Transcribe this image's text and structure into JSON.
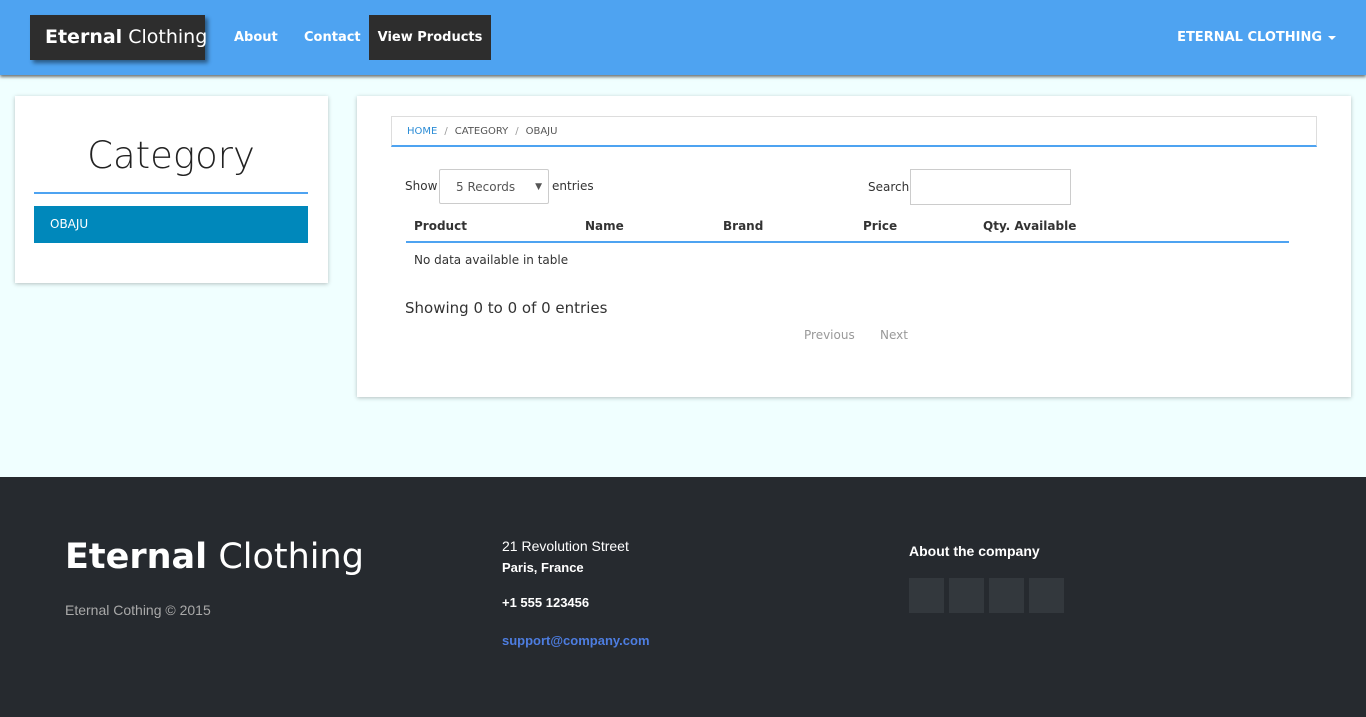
{
  "navbar": {
    "brand_bold": "Eternal",
    "brand_light": "Clothing",
    "links": [
      "About",
      "Contact"
    ],
    "active_link": "View Products",
    "right_menu": "ETERNAL CLOTHING",
    "colors": {
      "bar": "#4ea3f1",
      "brand_bg": "#2d2d2d"
    }
  },
  "sidebar": {
    "title": "Category",
    "items": [
      "OBAJU"
    ],
    "active_color": "#0088bb"
  },
  "main": {
    "breadcrumb": [
      "HOME",
      "CATEGORY",
      "OBAJU"
    ],
    "breadcrumb_sep": "/",
    "show_label": "Show",
    "records_select": "5 Records",
    "entries_label": "entries",
    "search_label": "Search:",
    "search_value": "",
    "columns": [
      "Product",
      "Name",
      "Brand",
      "Price",
      "Qty. Available"
    ],
    "empty_message": "No data available in table",
    "showing_text": "Showing 0 to 0 of 0 entries",
    "pager": {
      "previous": "Previous",
      "next": "Next"
    }
  },
  "footer": {
    "logo_bold": "Eternal",
    "logo_light": "Clothing",
    "copyright": "Eternal Cothing © 2015",
    "address_line1": "21 Revolution Street",
    "address_line2": "Paris, France",
    "phone": "+1 555 123456",
    "email": "support@company.com",
    "about_title": "About the company",
    "social_icons": [
      "social-icon-1",
      "social-icon-2",
      "social-icon-3",
      "social-icon-4"
    ]
  }
}
